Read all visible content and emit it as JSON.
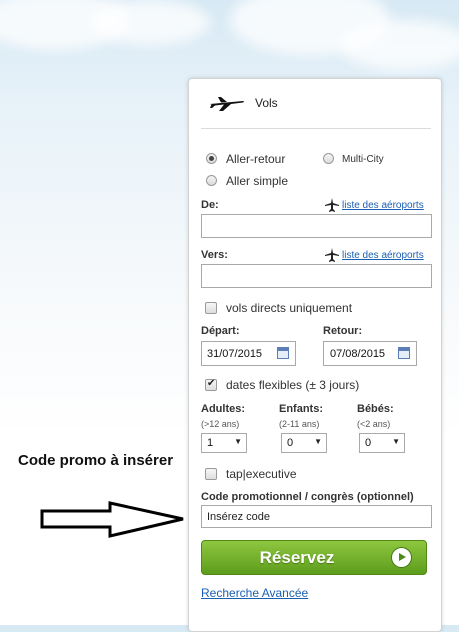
{
  "header": {
    "title": "Vols"
  },
  "trip_type": {
    "options": [
      {
        "label": "Aller-retour",
        "selected": true
      },
      {
        "label": "Multi-City",
        "selected": false
      },
      {
        "label": "Aller simple",
        "selected": false
      }
    ]
  },
  "from": {
    "label": "De:",
    "link": "liste des aéroports",
    "value": ""
  },
  "to": {
    "label": "Vers:",
    "link": "liste des aéroports",
    "value": ""
  },
  "direct_only": {
    "label": "vols directs uniquement",
    "checked": false
  },
  "departure": {
    "label": "Départ:",
    "value": "31/07/2015"
  },
  "return": {
    "label": "Retour:",
    "value": "07/08/2015"
  },
  "flexible": {
    "label": "dates flexibles (± 3 jours)",
    "checked": true
  },
  "passengers": {
    "adults": {
      "label": "Adultes:",
      "sub": "(>12 ans)",
      "value": "1"
    },
    "children": {
      "label": "Enfants:",
      "sub": "(2-11 ans)",
      "value": "0"
    },
    "infants": {
      "label": "Bébés:",
      "sub": "(<2 ans)",
      "value": "0"
    }
  },
  "tap_executive": {
    "label": "tap|executive",
    "checked": false
  },
  "promo": {
    "label": "Code promotionnel / congrès (optionnel)",
    "value": "Insérez code"
  },
  "submit": {
    "label": "Réservez"
  },
  "advanced_link": "Recherche Avancée",
  "annotation": {
    "text": "Code promo à insérer"
  },
  "colors": {
    "button": "#6aab26",
    "link": "#1a5fb4"
  },
  "icons": [
    "airplane-icon",
    "calendar-icon",
    "play-arrow-icon",
    "arrow-outline-icon"
  ]
}
